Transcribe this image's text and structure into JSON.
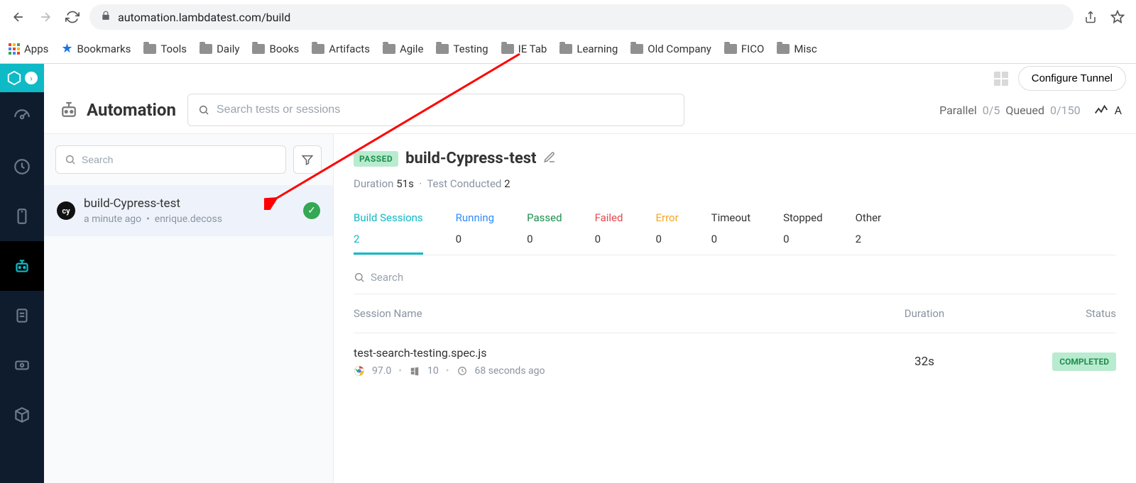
{
  "browser": {
    "url": "automation.lambdatest.com/build",
    "bookmarks": [
      "Apps",
      "Bookmarks",
      "Tools",
      "Daily",
      "Books",
      "Artifacts",
      "Agile",
      "Testing",
      "IE Tab",
      "Learning",
      "Old Company",
      "FICO",
      "Misc"
    ]
  },
  "header": {
    "configure_btn": "Configure Tunnel",
    "page_title": "Automation",
    "search_placeholder": "Search tests or sessions",
    "parallel_label": "Parallel",
    "parallel_value": "0/5",
    "queued_label": "Queued",
    "queued_value": "0/150"
  },
  "sidebar": {
    "search_placeholder": "Search",
    "build": {
      "name": "build-Cypress-test",
      "time": "a minute ago",
      "user": "enrique.decoss",
      "badge": "cy"
    }
  },
  "build": {
    "status": "PASSED",
    "title": "build-Cypress-test",
    "duration_label": "Duration",
    "duration_value": "51s",
    "conducted_label": "Test Conducted",
    "conducted_value": "2",
    "tabs": [
      {
        "label": "Build Sessions",
        "count": "2",
        "cls": "active"
      },
      {
        "label": "Running",
        "count": "0",
        "cls": "running"
      },
      {
        "label": "Passed",
        "count": "0",
        "cls": "passed"
      },
      {
        "label": "Failed",
        "count": "0",
        "cls": "failed"
      },
      {
        "label": "Error",
        "count": "0",
        "cls": "error"
      },
      {
        "label": "Timeout",
        "count": "0",
        "cls": ""
      },
      {
        "label": "Stopped",
        "count": "0",
        "cls": ""
      },
      {
        "label": "Other",
        "count": "2",
        "cls": ""
      }
    ],
    "session_search_placeholder": "Search",
    "table": {
      "col_name": "Session Name",
      "col_duration": "Duration",
      "col_status": "Status"
    },
    "session": {
      "name": "test-search-testing.spec.js",
      "browser": "97.0",
      "os": "10",
      "ago": "68 seconds ago",
      "duration": "32s",
      "status": "COMPLETED"
    }
  }
}
